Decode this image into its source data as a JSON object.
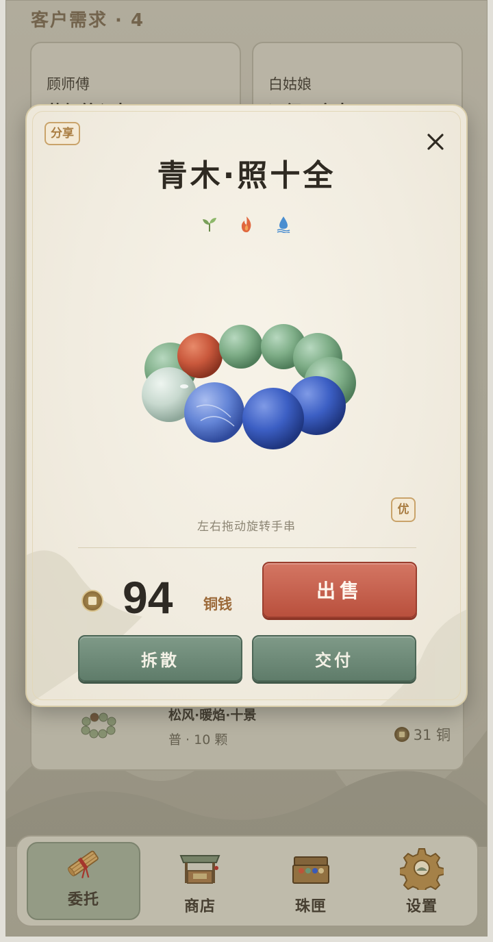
{
  "header": {
    "title": "客户需求 · 4"
  },
  "requests": [
    {
      "name": "顾师傅",
      "wish": "草气养心串"
    },
    {
      "name": "白姑娘",
      "wish": "远行平安串"
    }
  ],
  "list_item": {
    "title": "松风·暖焰·十景",
    "subtitle": "普 · 10 颗",
    "price": "31 铜"
  },
  "modal": {
    "share_label": "分享",
    "close_icon": "close-icon",
    "title": "青木·照十全",
    "elements": [
      "sprout-icon",
      "flame-icon",
      "water-drop-icon"
    ],
    "quality_badge": "优",
    "hint": "左右拖动旋转手串",
    "price_value": "94",
    "price_unit": "铜钱",
    "sell_label": "出售",
    "disband_label": "拆散",
    "deliver_label": "交付",
    "bead_colors": {
      "jade": "#7fae88",
      "red": "#c9583c",
      "white": "#c8d9cf",
      "blue": "#3c5fc4"
    }
  },
  "nav": {
    "items": [
      {
        "label": "委托",
        "icon": "scroll-bundle-icon",
        "active": true
      },
      {
        "label": "商店",
        "icon": "shop-stall-icon",
        "active": false
      },
      {
        "label": "珠匣",
        "icon": "treasure-chest-icon",
        "active": false
      },
      {
        "label": "设置",
        "icon": "gear-icon",
        "active": false
      }
    ]
  },
  "colors": {
    "sell_button": "#c2574a",
    "action_button": "#6b8776",
    "badge_border": "#c9a36a",
    "title_text": "#2f2a22"
  }
}
